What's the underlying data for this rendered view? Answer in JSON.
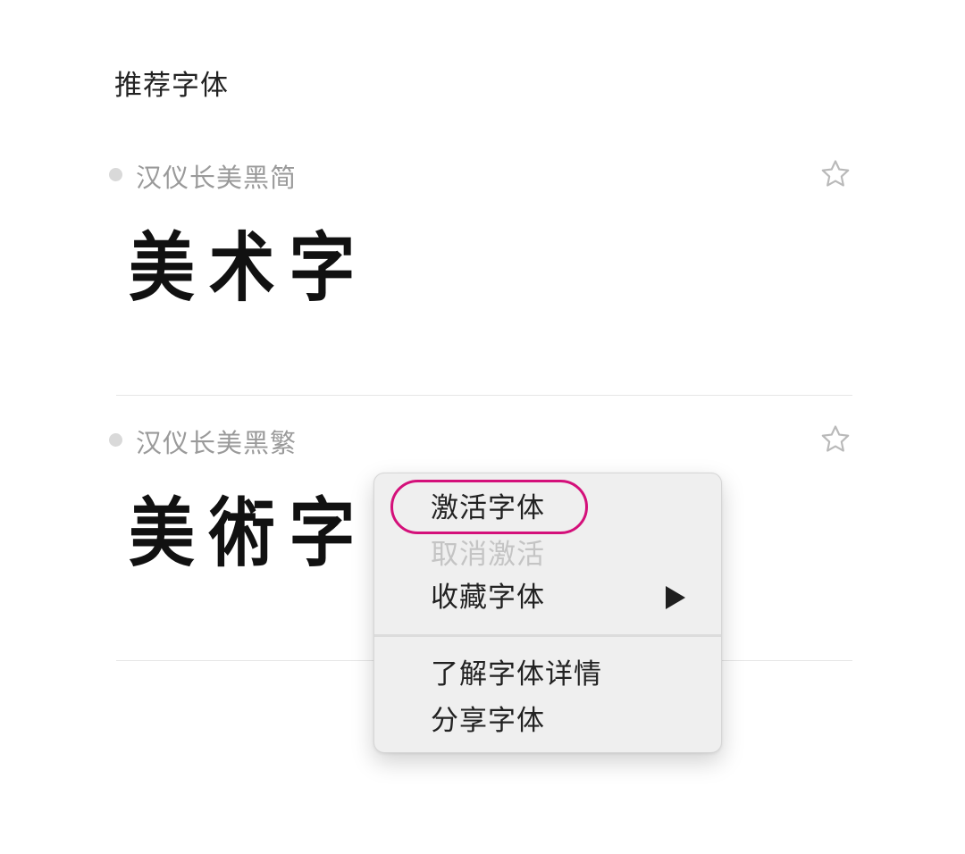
{
  "page": {
    "section_title": "推荐字体"
  },
  "fonts": [
    {
      "name": "汉仪长美黑简",
      "preview": "美术字",
      "favorite_icon": "star-outline-icon",
      "status_icon": "inactive-dot-icon"
    },
    {
      "name": "汉仪长美黑繁",
      "preview": "美術字",
      "favorite_icon": "star-outline-icon",
      "status_icon": "inactive-dot-icon"
    }
  ],
  "context_menu": {
    "items": [
      {
        "label": "激活字体",
        "enabled": true,
        "highlighted": true
      },
      {
        "label": "取消激活",
        "enabled": false
      },
      {
        "label": "收藏字体",
        "enabled": true,
        "submenu_icon": "triangle-right-icon"
      },
      {
        "label": "了解字体详情",
        "enabled": true
      },
      {
        "label": "分享字体",
        "enabled": true
      }
    ],
    "highlight_color": "#d4107a"
  },
  "colors": {
    "background": "#ffffff",
    "menu_background": "#efefef",
    "title_text": "#222222",
    "muted_text": "#9a9a9a",
    "disabled_text": "#c4c4c4"
  }
}
